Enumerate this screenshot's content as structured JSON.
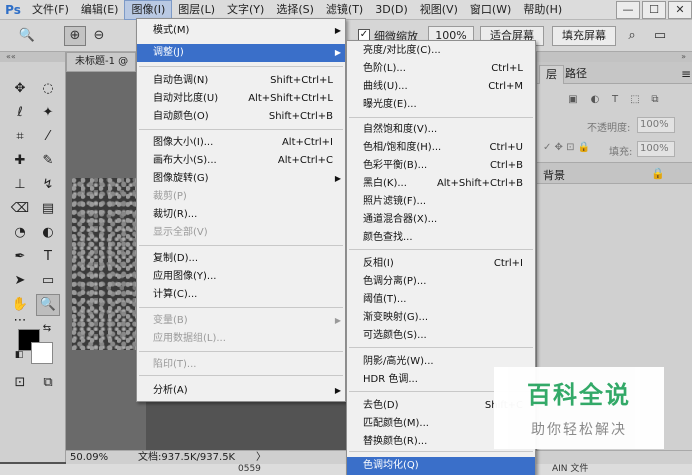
{
  "app": {
    "logo": "Ps",
    "menubar": [
      "文件(F)",
      "编辑(E)",
      "图像(I)",
      "图层(L)",
      "文字(Y)",
      "选择(S)",
      "滤镜(T)",
      "3D(D)",
      "视图(V)",
      "窗口(W)",
      "帮助(H)"
    ],
    "window_controls": [
      "—",
      "☐",
      "✕"
    ]
  },
  "options_bar": {
    "scrubby_zoom_label": "细微缩放",
    "zoom_100_label": "100%",
    "fit_screen_label": "适合屏幕",
    "fill_screen_label": "填充屏幕"
  },
  "document": {
    "tab_title": "未标题-1 @",
    "zoom": "50.09%",
    "doc_size": "文档:937.5K/937.5K",
    "status_arrow": "〉",
    "bottom_number": "0559",
    "bottom_right": "AIN 文件"
  },
  "image_menu": {
    "items": [
      {
        "label": "模式(M)",
        "shortcut": "",
        "submenu": true,
        "disabled": false,
        "highlight": false
      },
      {
        "label": "调整(J)",
        "shortcut": "",
        "submenu": true,
        "disabled": false,
        "highlight": true
      },
      {
        "label": "自动色调(N)",
        "shortcut": "Shift+Ctrl+L",
        "submenu": false,
        "disabled": false,
        "highlight": false
      },
      {
        "label": "自动对比度(U)",
        "shortcut": "Alt+Shift+Ctrl+L",
        "submenu": false,
        "disabled": false,
        "highlight": false
      },
      {
        "label": "自动颜色(O)",
        "shortcut": "Shift+Ctrl+B",
        "submenu": false,
        "disabled": false,
        "highlight": false
      },
      {
        "label": "图像大小(I)...",
        "shortcut": "Alt+Ctrl+I",
        "submenu": false,
        "disabled": false,
        "highlight": false
      },
      {
        "label": "画布大小(S)...",
        "shortcut": "Alt+Ctrl+C",
        "submenu": false,
        "disabled": false,
        "highlight": false
      },
      {
        "label": "图像旋转(G)",
        "shortcut": "",
        "submenu": true,
        "disabled": false,
        "highlight": false
      },
      {
        "label": "裁剪(P)",
        "shortcut": "",
        "submenu": false,
        "disabled": true,
        "highlight": false
      },
      {
        "label": "裁切(R)...",
        "shortcut": "",
        "submenu": false,
        "disabled": false,
        "highlight": false
      },
      {
        "label": "显示全部(V)",
        "shortcut": "",
        "submenu": false,
        "disabled": true,
        "highlight": false
      },
      {
        "label": "复制(D)...",
        "shortcut": "",
        "submenu": false,
        "disabled": false,
        "highlight": false
      },
      {
        "label": "应用图像(Y)...",
        "shortcut": "",
        "submenu": false,
        "disabled": false,
        "highlight": false
      },
      {
        "label": "计算(C)...",
        "shortcut": "",
        "submenu": false,
        "disabled": false,
        "highlight": false
      },
      {
        "label": "变量(B)",
        "shortcut": "",
        "submenu": true,
        "disabled": true,
        "highlight": false
      },
      {
        "label": "应用数据组(L)...",
        "shortcut": "",
        "submenu": false,
        "disabled": true,
        "highlight": false
      },
      {
        "label": "陷印(T)...",
        "shortcut": "",
        "submenu": false,
        "disabled": true,
        "highlight": false
      },
      {
        "label": "分析(A)",
        "shortcut": "",
        "submenu": true,
        "disabled": false,
        "highlight": false
      }
    ]
  },
  "adjust_submenu": {
    "items": [
      {
        "label": "亮度/对比度(C)...",
        "shortcut": "",
        "highlight": false
      },
      {
        "label": "色阶(L)...",
        "shortcut": "Ctrl+L",
        "highlight": false
      },
      {
        "label": "曲线(U)...",
        "shortcut": "Ctrl+M",
        "highlight": false
      },
      {
        "label": "曝光度(E)...",
        "shortcut": "",
        "highlight": false
      },
      {
        "label": "自然饱和度(V)...",
        "shortcut": "",
        "highlight": false
      },
      {
        "label": "色相/饱和度(H)...",
        "shortcut": "Ctrl+U",
        "highlight": false
      },
      {
        "label": "色彩平衡(B)...",
        "shortcut": "Ctrl+B",
        "highlight": false
      },
      {
        "label": "黑白(K)...",
        "shortcut": "Alt+Shift+Ctrl+B",
        "highlight": false
      },
      {
        "label": "照片滤镜(F)...",
        "shortcut": "",
        "highlight": false
      },
      {
        "label": "通道混合器(X)...",
        "shortcut": "",
        "highlight": false
      },
      {
        "label": "颜色查找...",
        "shortcut": "",
        "highlight": false
      },
      {
        "label": "反相(I)",
        "shortcut": "Ctrl+I",
        "highlight": false
      },
      {
        "label": "色调分离(P)...",
        "shortcut": "",
        "highlight": false
      },
      {
        "label": "阈值(T)...",
        "shortcut": "",
        "highlight": false
      },
      {
        "label": "渐变映射(G)...",
        "shortcut": "",
        "highlight": false
      },
      {
        "label": "可选颜色(S)...",
        "shortcut": "",
        "highlight": false
      },
      {
        "label": "阴影/高光(W)...",
        "shortcut": "",
        "highlight": false
      },
      {
        "label": "HDR 色调...",
        "shortcut": "",
        "highlight": false
      },
      {
        "label": "去色(D)",
        "shortcut": "Shift+C",
        "highlight": false
      },
      {
        "label": "匹配颜色(M)...",
        "shortcut": "",
        "highlight": false
      },
      {
        "label": "替换颜色(R)...",
        "shortcut": "",
        "highlight": false
      },
      {
        "label": "色调均化(Q)",
        "shortcut": "",
        "highlight": true
      }
    ]
  },
  "layers_panel": {
    "tab_active": "层",
    "tab_other": "路径",
    "opacity_label": "不透明度:",
    "opacity_value": "100%",
    "fill_label": "填充:",
    "fill_value": "100%",
    "layer_name": "背景"
  },
  "watermark": {
    "title": "百科全说",
    "subtitle": "助你轻松解决"
  },
  "colors": {
    "menu_highlight": "#3a6fc9",
    "foreground": "#000000",
    "background": "#ffffff",
    "watermark_green": "#2ea865"
  }
}
